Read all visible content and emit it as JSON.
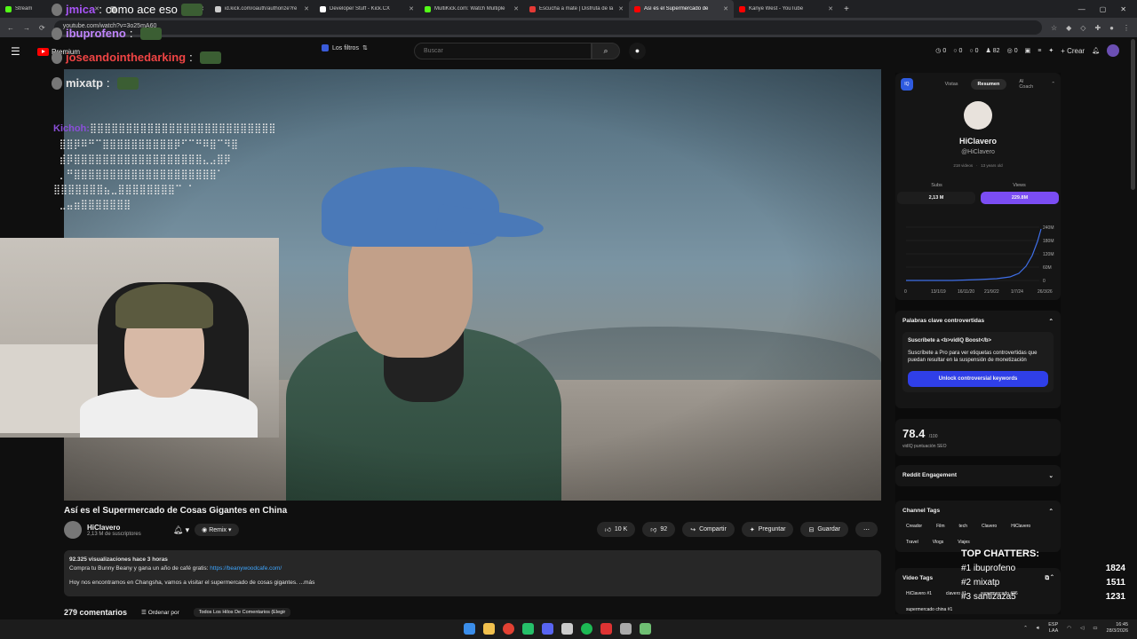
{
  "browser": {
    "tabs": [
      {
        "label": "Stream",
        "color": "#53fc18"
      },
      {
        "label": "",
        "color": "#888888"
      },
      {
        "label": "id.kick.com/oauth/authorize?re",
        "color": "#cccccc"
      },
      {
        "label": "Developer Stuff - Kick.CX",
        "color": "#ffffff"
      },
      {
        "label": "MultiKick.com: Watch Multiple",
        "color": "#53fc18"
      },
      {
        "label": "Escucha a mate | Disfruta de la",
        "color": "#e53935"
      },
      {
        "label": "Así es el Supermercado de",
        "color": "#ff0000",
        "active": true
      },
      {
        "label": "Kanye West - YouTube",
        "color": "#ff0000"
      }
    ],
    "url": "youtube.com/watch?v=3o25mA60"
  },
  "youtube": {
    "premium_label": "Premium",
    "filters_label": "Los filtros",
    "search_placeholder": "Buscar",
    "header_stats": [
      "0",
      "0",
      "0",
      "82",
      "0"
    ],
    "create_label": "Crear"
  },
  "overlay_chat": [
    {
      "user": "jmica",
      "text": "como ace eso",
      "color": "#a855f7"
    },
    {
      "user": "ibuprofeno",
      "text": "",
      "color": "#c084fc"
    },
    {
      "user": "joseandointhedarking",
      "text": "",
      "color": "#ef4444"
    },
    {
      "user": "mixatp",
      "text": "",
      "color": "#e5e5e5"
    }
  ],
  "ascii_user": "Kichoh:",
  "ascii_lines": [
    "⣿⣿⣿⣿⣿⣿⣿⣿⣿⣿⣿⣿⣿⣿⣿⣿⣿⣿⣿⣿⣿⣿⣿⣿⣿⣿",
    " ⣿⣿⡿⠿⠛⠉⣿⣿⣿⣿⣿⣿⣿⣿⣿⣿⡿⠋⠉⠛⠿⣿⠉⠻⣿",
    " ⣾⡿⣿⣿⣿⣿⣿⣿⣿⣿⣿⣿⣿⣿⣿⣿⣿⣿⣿⣿⣄⣠⣿⡿",
    " ⡀⠛⣿⣿⣿⣿⣿⣿⣿⣿⣿⣿⣿⣿⣿⣿⣿⣿⣿⣿⣿⣿⠁",
    "⣿⣿⣿⣿⣿⣿⣿⣦⣀⣿⣿⣿⣿⣿⣿⣿⣿⠉ ⠁",
    " ⣀⣤⣶⣿⣿⣿⣿⣿⣿⣿"
  ],
  "video": {
    "title": "Así es el Supermercado de Cosas Gigantes en China",
    "channel": "HiClavero",
    "subs": "2,13 M de suscriptores",
    "remix": "Remix",
    "likes": "10 K",
    "dislikes": "92",
    "share": "Compartir",
    "ask": "Preguntar",
    "save": "Guardar",
    "views_line": "92.325 visualizaciones  hace 3 horas",
    "promo_line": "Compra tu Bunny Beany y gana un año de café gratis:",
    "promo_link": "https://beanywoodcafe.com/",
    "desc_line": "Hoy nos encontramos en Changsha, vamos a visitar el supermercado de cosas gigantes.",
    "more": "...más",
    "comments_count": "279 comentarios",
    "sort_label": "Ordenar por",
    "threads_label": "Todos Los Hilos De Comentarios (Elegir"
  },
  "vidiq": {
    "tabs": [
      "Vistas",
      "Resumen",
      "AI Coach"
    ],
    "name": "HiClavero",
    "handle": "@HiClavero",
    "meta_videos": "218 videos",
    "meta_years": "13 years old",
    "subs_label": "Subs",
    "views_label": "Views",
    "subs_value": "2,13 M",
    "views_value": "229.8M",
    "chart_y": [
      "240M",
      "180M",
      "120M",
      "60M",
      "0"
    ],
    "chart_x": [
      "0",
      "13/1/19",
      "16/11/20",
      "21/9/22",
      "1/7/24",
      "26/3/26"
    ],
    "keywords_title": "Palabras clave controvertidas",
    "promo_head": "Suscríbete a <b>vidIQ Boost</b>",
    "promo_body": "Suscríbete a Pro para ver etiquetas controvertidas que puedan resultar en la suspensión de monetización",
    "unlock": "Unlock controversial keywords",
    "seo_score": "78.4",
    "seo_of": "/100",
    "seo_label": "vidIQ puntuación SEO",
    "reddit": "Reddit Engagement",
    "tags_title": "Channel Tags",
    "tags": [
      "Creador",
      "Film",
      "tech",
      "Clavero",
      "HiClavero",
      "Travel",
      "Vlogs",
      "Viajes"
    ],
    "video_tags_title": "Video Tags",
    "video_tags": [
      "HiClavero #1",
      "clavero #1",
      "supermercado #36",
      "supermercado china #1"
    ]
  },
  "top_chatters": {
    "title": "TOP CHATTERS:",
    "rows": [
      {
        "name": "#1 ibuprofeno",
        "value": "1824"
      },
      {
        "name": "#2 mixatp",
        "value": "1511"
      },
      {
        "name": "#3 santizaza5",
        "value": "1231"
      }
    ]
  },
  "taskbar": {
    "lang_top": "ESP",
    "lang_bottom": "LAA",
    "time": "16:45",
    "date": "28/3/2026"
  }
}
